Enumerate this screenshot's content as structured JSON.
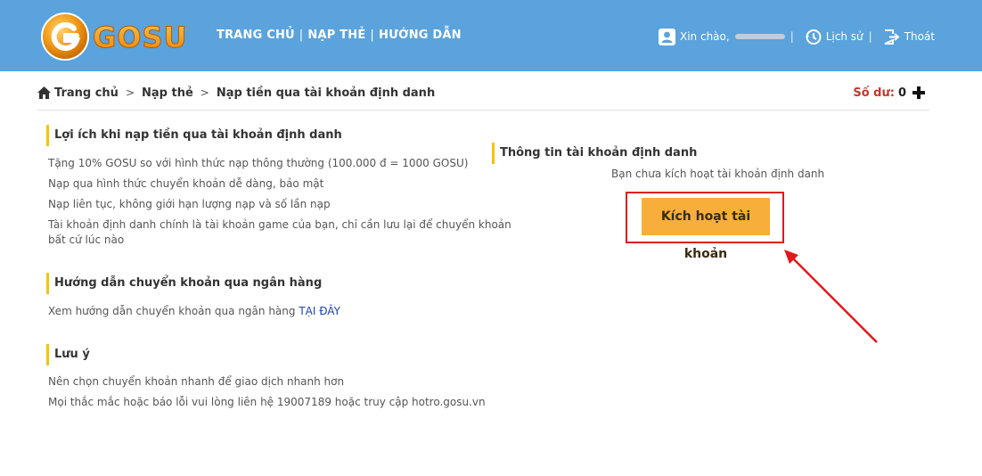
{
  "header": {
    "logo_text": "GOSU",
    "nav": [
      "TRANG CHỦ",
      "NẠP THẺ",
      "HƯỚNG DẪN"
    ],
    "greeting": "Xin chào,",
    "history_label": "Lịch sử",
    "logout_label": "Thoát",
    "colors": {
      "bar": "#5aa3dc",
      "logo_orange": "#f39c1a"
    }
  },
  "breadcrumb": {
    "items": [
      "Trang chủ",
      "Nạp thẻ",
      "Nạp tiền qua tài khoản định danh"
    ]
  },
  "balance": {
    "label": "Số dư:",
    "value": "0"
  },
  "benefits": {
    "title": "Lợi ích khi nạp tiền qua tài khoản định danh",
    "lines": [
      "Tặng 10% GOSU so với hình thức nạp thông thường (100.000 đ = 1000 GOSU)",
      "Nạp qua hình thức chuyển khoản dễ dàng, bảo mật",
      "Nạp liên tục, không giới hạn lượng nạp và số lần nạp",
      "Tài khoản định danh chính là tài khoản game của bạn, chỉ cần lưu lại để chuyển khoản",
      "bất cứ lúc nào"
    ]
  },
  "guide": {
    "title": "Hướng dẫn chuyển khoản qua ngân hàng",
    "text": "Xem hướng dẫn chuyển khoản qua ngân hàng",
    "link": "TẠI ĐÂY"
  },
  "notes": {
    "title": "Lưu ý",
    "lines": [
      "Nên chọn chuyển khoản nhanh để giao dịch nhanh hơn",
      "Mọi thắc mắc hoặc báo lỗi vui lòng liên hệ 19007189 hoặc truy cập hotro.gosu.vn"
    ]
  },
  "account_info": {
    "title": "Thông tin tài khoản định danh",
    "status": "Bạn chưa kích hoạt tài khoản định danh",
    "activate_button": "Kích hoạt tài khoản"
  }
}
